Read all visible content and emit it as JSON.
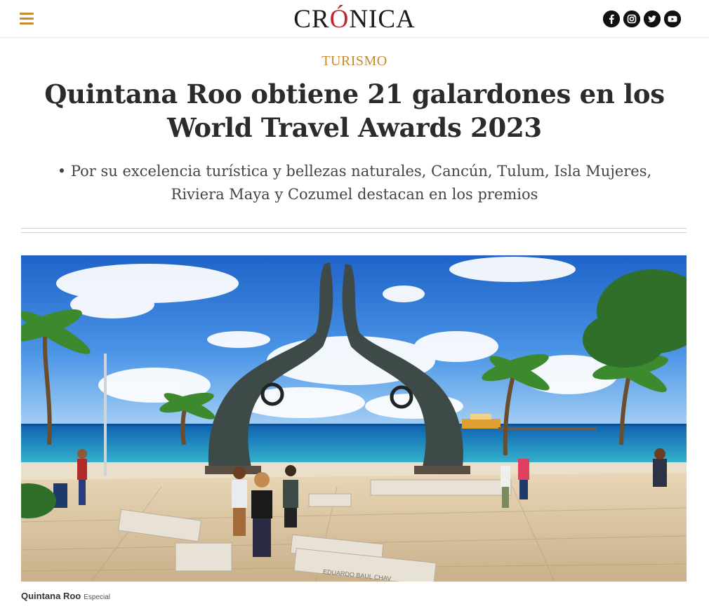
{
  "header": {
    "logo_pre": "CR",
    "logo_accent": "Ó",
    "logo_post": "NICA",
    "menu_icon": "hamburger-icon",
    "socials": [
      {
        "name": "facebook",
        "glyph": "f"
      },
      {
        "name": "instagram",
        "glyph": ""
      },
      {
        "name": "twitter",
        "glyph": ""
      },
      {
        "name": "youtube",
        "glyph": ""
      }
    ]
  },
  "article": {
    "section": "TURISMO",
    "headline_line1": "Quintana Roo obtiene 21 galardones en los",
    "headline_line2": "World Travel Awards 2023",
    "subhead_line1": "• Por su excelencia turística y bellezas naturales, Cancún, Tulum, Isla Mujeres,",
    "subhead_line2": "Riviera Maya y Cozumel destacan en los premios"
  },
  "image": {
    "alt": "Quintana Roo",
    "caption": "Quintana Roo",
    "credit": "Especial",
    "engraving": "EDUARDO BAUL CHAV"
  },
  "colors": {
    "accent": "#c98a2d",
    "logo_accent": "#c0272d",
    "headline": "#2b2b2b"
  }
}
